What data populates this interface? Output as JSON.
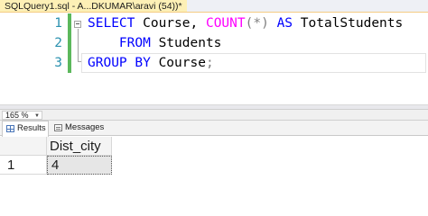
{
  "tab": {
    "title": "SQLQuery1.sql - A...DKUMAR\\aravi (54))*"
  },
  "editor": {
    "line_numbers": [
      "1",
      "2",
      "3"
    ],
    "lines": [
      {
        "kw1": "SELECT",
        "t1": " Course, ",
        "fn": "COUNT",
        "op1": "(*)",
        "sp": " ",
        "kw2": "AS",
        "t2": " TotalStudents"
      },
      {
        "indent": "    ",
        "kw1": "FROM",
        "t1": " Students"
      },
      {
        "kw1": "GROUP BY",
        "t1": " Course",
        "op1": ";"
      }
    ]
  },
  "zoom": {
    "value": "165 %"
  },
  "results": {
    "tabs": [
      {
        "label": "Results",
        "icon": "grid-icon"
      },
      {
        "label": "Messages",
        "icon": "messages-icon"
      }
    ],
    "columns": [
      "Dist_city"
    ],
    "rows": [
      {
        "row_number": "1",
        "cells": [
          "4"
        ]
      }
    ]
  },
  "colors": {
    "keyword": "#0000ff",
    "function": "#ff00ff",
    "operator": "#808080",
    "line_number": "#2b91af",
    "change_bar": "#5cb85c",
    "active_tab": "#fdf0b6"
  }
}
